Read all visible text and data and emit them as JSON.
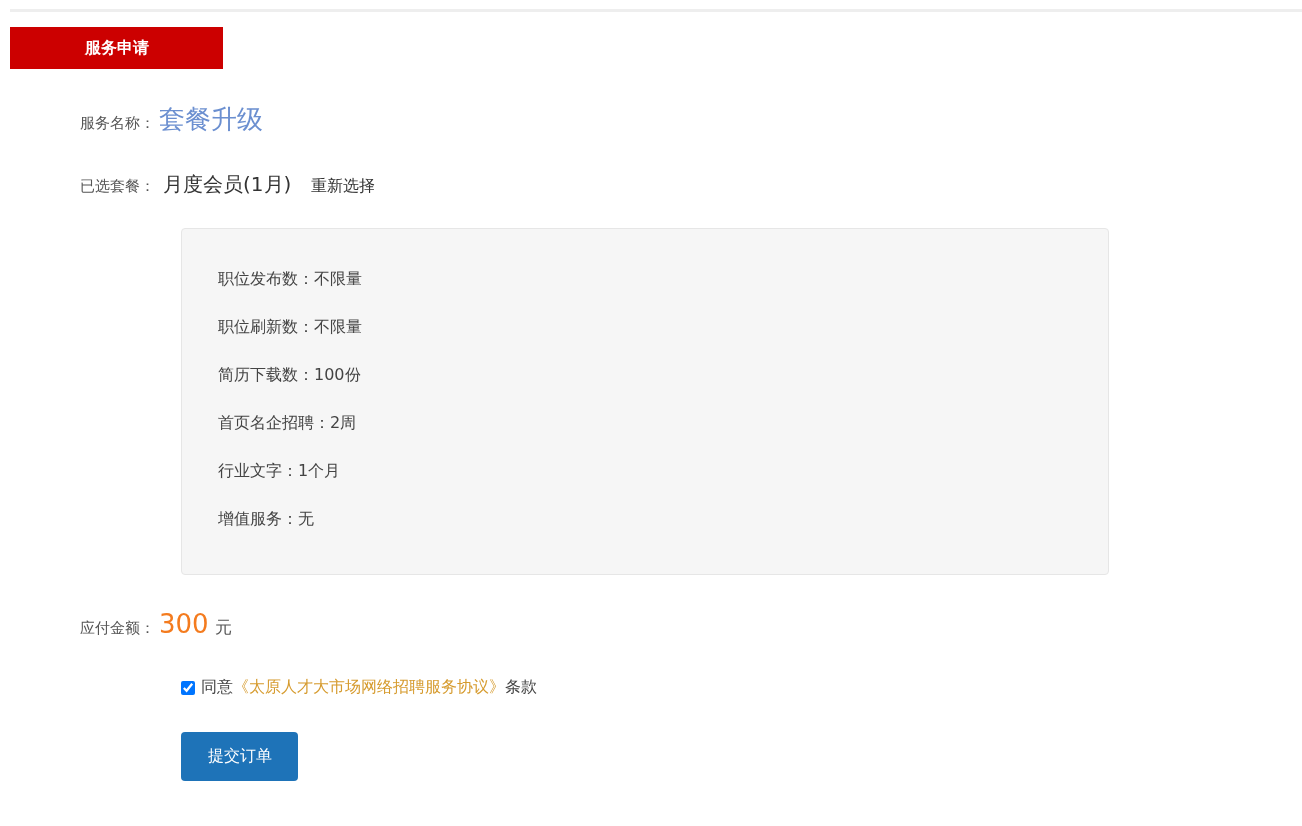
{
  "section_tab": {
    "label": "服务申请"
  },
  "service_name": {
    "label": "服务名称：",
    "value": "套餐升级"
  },
  "selected_package": {
    "label": "已选套餐：",
    "value": "月度会员(1月)",
    "reselect_link": "重新选择"
  },
  "package_features": [
    {
      "text": "职位发布数：不限量"
    },
    {
      "text": "职位刷新数：不限量"
    },
    {
      "text": "简历下载数：100份"
    },
    {
      "text": "首页名企招聘：2周"
    },
    {
      "text": "行业文字：1个月"
    },
    {
      "text": "增值服务：无"
    }
  ],
  "amount": {
    "label": "应付金额：",
    "value": "300",
    "unit": "元"
  },
  "agreement": {
    "checked": true,
    "prefix": "同意",
    "link": "《太原人才大市场网络招聘服务协议》",
    "suffix": "条款"
  },
  "submit_button": {
    "label": "提交订单"
  }
}
